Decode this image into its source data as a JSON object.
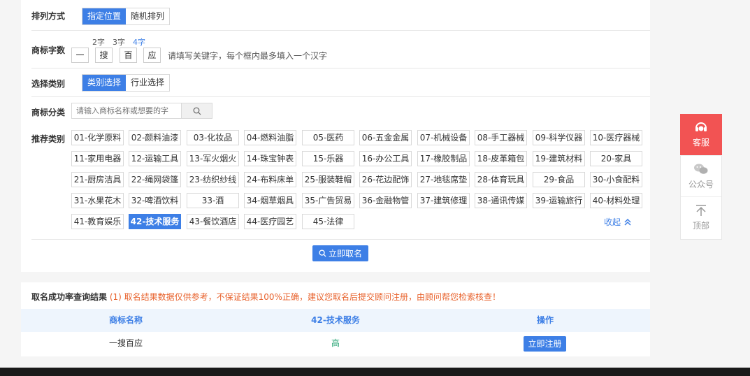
{
  "sort": {
    "label": "排列方式",
    "options": [
      "指定位置",
      "随机排列"
    ]
  },
  "count": {
    "label": "商标字数",
    "lengths": [
      "2字",
      "3字",
      "4字"
    ],
    "chars": [
      "一",
      "搜",
      "百",
      "应"
    ],
    "hint": "请填写关键字，每个框内最多填入一个汉字"
  },
  "type": {
    "label": "选择类别",
    "options": [
      "类别选择",
      "行业选择"
    ]
  },
  "classify": {
    "label": "商标分类",
    "placeholder": "请输入商标名称或想要的字"
  },
  "recommend": {
    "label": "推荐类别",
    "categories": [
      "01-化学原料",
      "02-颜料油漆",
      "03-化妆品",
      "04-燃料油脂",
      "05-医药",
      "06-五金金属",
      "07-机械设备",
      "08-手工器械",
      "09-科学仪器",
      "10-医疗器械",
      "11-家用电器",
      "12-运输工具",
      "13-军火烟火",
      "14-珠宝钟表",
      "15-乐器",
      "16-办公工具",
      "17-橡胶制品",
      "18-皮革箱包",
      "19-建筑材料",
      "20-家具",
      "21-厨房洁具",
      "22-绳网袋篷",
      "23-纺织纱线",
      "24-布料床单",
      "25-服装鞋帽",
      "26-花边配饰",
      "27-地毯席垫",
      "28-体育玩具",
      "29-食品",
      "30-小食配料",
      "31-水果花木",
      "32-啤酒饮料",
      "33-酒",
      "34-烟草烟具",
      "35-广告贸易",
      "36-金融物管",
      "37-建筑修理",
      "38-通讯传媒",
      "39-运输旅行",
      "40-材料处理",
      "41-教育娱乐",
      "42-技术服务",
      "43-餐饮酒店",
      "44-医疗园艺",
      "45-法律"
    ],
    "selected": "42-技术服务",
    "collapse": "收起"
  },
  "action": {
    "go": "立即取名"
  },
  "result": {
    "title": "取名成功率查询结果",
    "note": "(1) 取名结果数据仅供参考，不保证结果100%正确，建议您取名后提交顾问注册，由顾问帮您检索核查！",
    "headers": [
      "商标名称",
      "42-技术服务",
      "操作"
    ],
    "row": {
      "name": "一搜百应",
      "rate": "高",
      "button": "立即注册"
    }
  },
  "side": {
    "service": "客服",
    "wechat": "公众号",
    "top": "顶部"
  },
  "colors": {
    "accent": "#3d7fe6",
    "danger": "#f25353",
    "success": "#2aa676",
    "warn": "#e8622c"
  }
}
